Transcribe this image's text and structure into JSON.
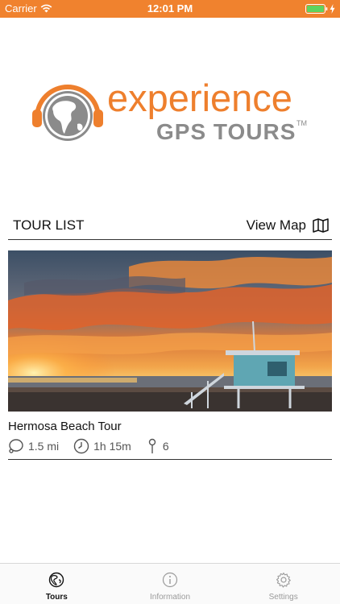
{
  "status_bar": {
    "carrier": "Carrier",
    "time": "12:01 PM"
  },
  "logo": {
    "word": "experience",
    "sub": "GPS TOURS",
    "tm": "TM"
  },
  "list_header": {
    "title": "TOUR LIST",
    "view_map": "View Map"
  },
  "tours": [
    {
      "name": "Hermosa Beach Tour",
      "distance": "1.5 mi",
      "duration": "1h 15m",
      "stops": "6"
    }
  ],
  "tab_bar": {
    "tabs": [
      {
        "label": "Tours",
        "icon": "globe-icon",
        "active": true
      },
      {
        "label": "Information",
        "icon": "info-icon",
        "active": false
      },
      {
        "label": "Settings",
        "icon": "gear-icon",
        "active": false
      }
    ]
  },
  "colors": {
    "accent": "#f0822e",
    "logo_orange": "#ee7f2d",
    "logo_gray": "#8b8b8b"
  }
}
